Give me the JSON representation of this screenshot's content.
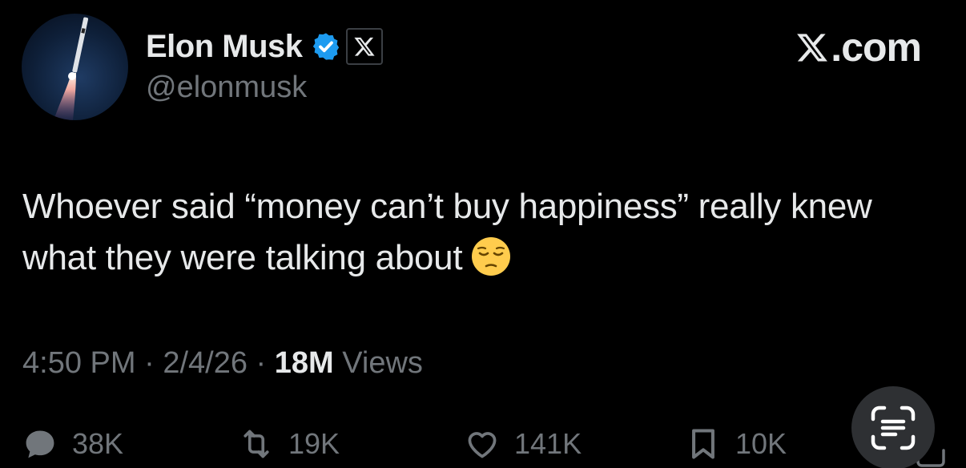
{
  "author": {
    "display_name": "Elon Musk",
    "handle": "@elonmusk",
    "avatar_icon": "rocket-launch-avatar",
    "verified_icon": "verified-badge-icon",
    "affiliate_icon": "x-logo-icon"
  },
  "brand": {
    "label": ".com",
    "logo_icon": "x-logo-icon"
  },
  "tweet": {
    "text": "Whoever said “money can’t buy happiness” really knew what they were talking about",
    "emoji": "pensive-face-emoji"
  },
  "meta": {
    "time": "4:50 PM",
    "separator": "·",
    "date": "2/4/26",
    "views_count": "18M",
    "views_label": "Views"
  },
  "actions": {
    "replies": "38K",
    "reposts": "19K",
    "likes": "141K",
    "bookmarks": "10K"
  },
  "colors": {
    "background": "#000000",
    "text_primary": "#e7e9ea",
    "text_secondary": "#71767b",
    "verified_blue": "#1d9bf0"
  }
}
